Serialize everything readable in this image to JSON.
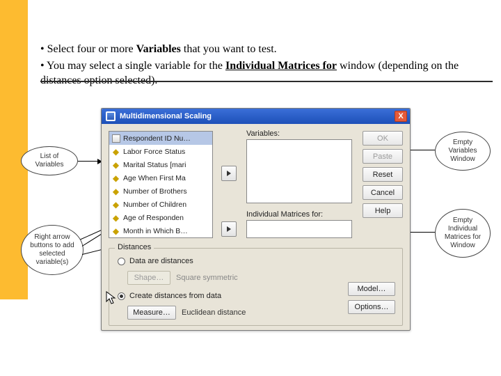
{
  "bullets": {
    "l1a": "• Select four or more ",
    "l1b": "Variables",
    "l1c": " that you want to test.",
    "l2a": "• You may select a single variable for the ",
    "l2b": "Individual Matrices for",
    "l2c": " window (depending on the distances option selected)."
  },
  "dialog": {
    "title": "Multidimensional Scaling",
    "close": "X",
    "variables_label": "Variables:",
    "indiv_label": "Individual Matrices for:",
    "varlist": [
      "Respondent ID Nu…",
      "Labor Force Status",
      "Marital Status [mari",
      "Age When First Ma",
      "Number of Brothers",
      "Number of Children",
      "Age of Responden",
      "Month in Which B…"
    ],
    "buttons": {
      "ok": "OK",
      "paste": "Paste",
      "reset": "Reset",
      "cancel": "Cancel",
      "help": "Help",
      "model": "Model…",
      "options": "Options…"
    },
    "group": {
      "label": "Distances",
      "r1": "Data are distances",
      "shape": "Shape…",
      "shape_val": "Square symmetric",
      "r2": "Create distances from data",
      "measure": "Measure…",
      "measure_val": "Euclidean distance"
    }
  },
  "bubbles": {
    "b1": "List of Variables",
    "b2": "Right arrow buttons to add selected variable(s)",
    "b3": "Empty Variables Window",
    "b4": "Empty Individual Matrices for Window"
  }
}
